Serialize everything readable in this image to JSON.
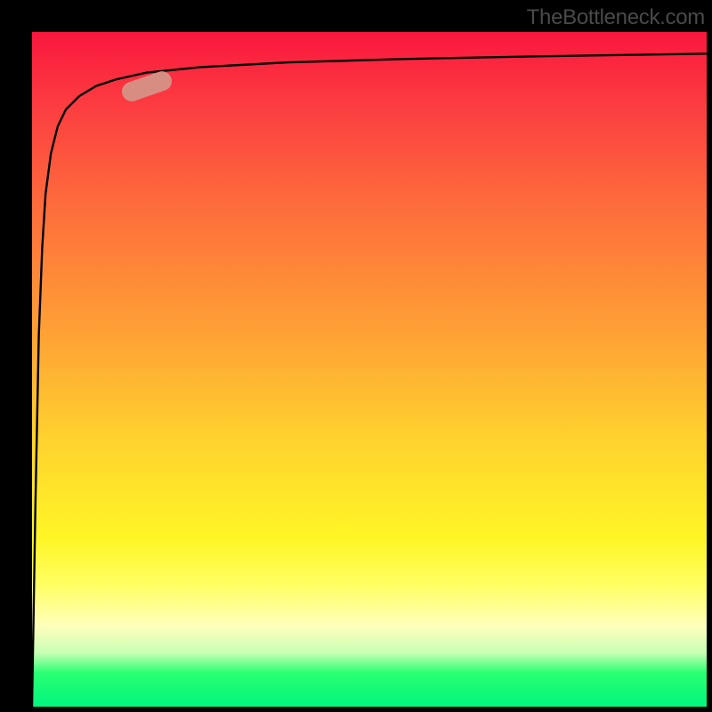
{
  "attribution": "TheBottleneck.com",
  "colors": {
    "frame": "#000000",
    "curve": "#000000",
    "marker": "#d88d82"
  },
  "chart_data": {
    "type": "line",
    "title": "",
    "xlabel": "",
    "ylabel": "",
    "xlim": [
      0,
      100
    ],
    "ylim": [
      0,
      100
    ],
    "grid": false,
    "legend": false,
    "series": [
      {
        "name": "curve",
        "x": [
          0.0,
          0.5,
          1.0,
          1.5,
          2.0,
          2.8,
          3.8,
          5.0,
          7.0,
          9.5,
          12.5,
          17.0,
          25.0,
          38.0,
          55.0,
          75.0,
          100.0
        ],
        "y": [
          0.0,
          30.0,
          55.0,
          68.0,
          76.0,
          82.0,
          86.0,
          88.5,
          90.5,
          92.0,
          93.0,
          94.0,
          94.8,
          95.5,
          96.0,
          96.4,
          96.8
        ],
        "note": "y-values are read off the vertical position of the curve as a percentage of the plot height (0 = bottom edge, 100 = top edge). Values approximate a rapidly-saturating log-like curve."
      }
    ],
    "marker": {
      "x_pct": 17,
      "y_pct": 92,
      "angle_deg": -19
    }
  }
}
